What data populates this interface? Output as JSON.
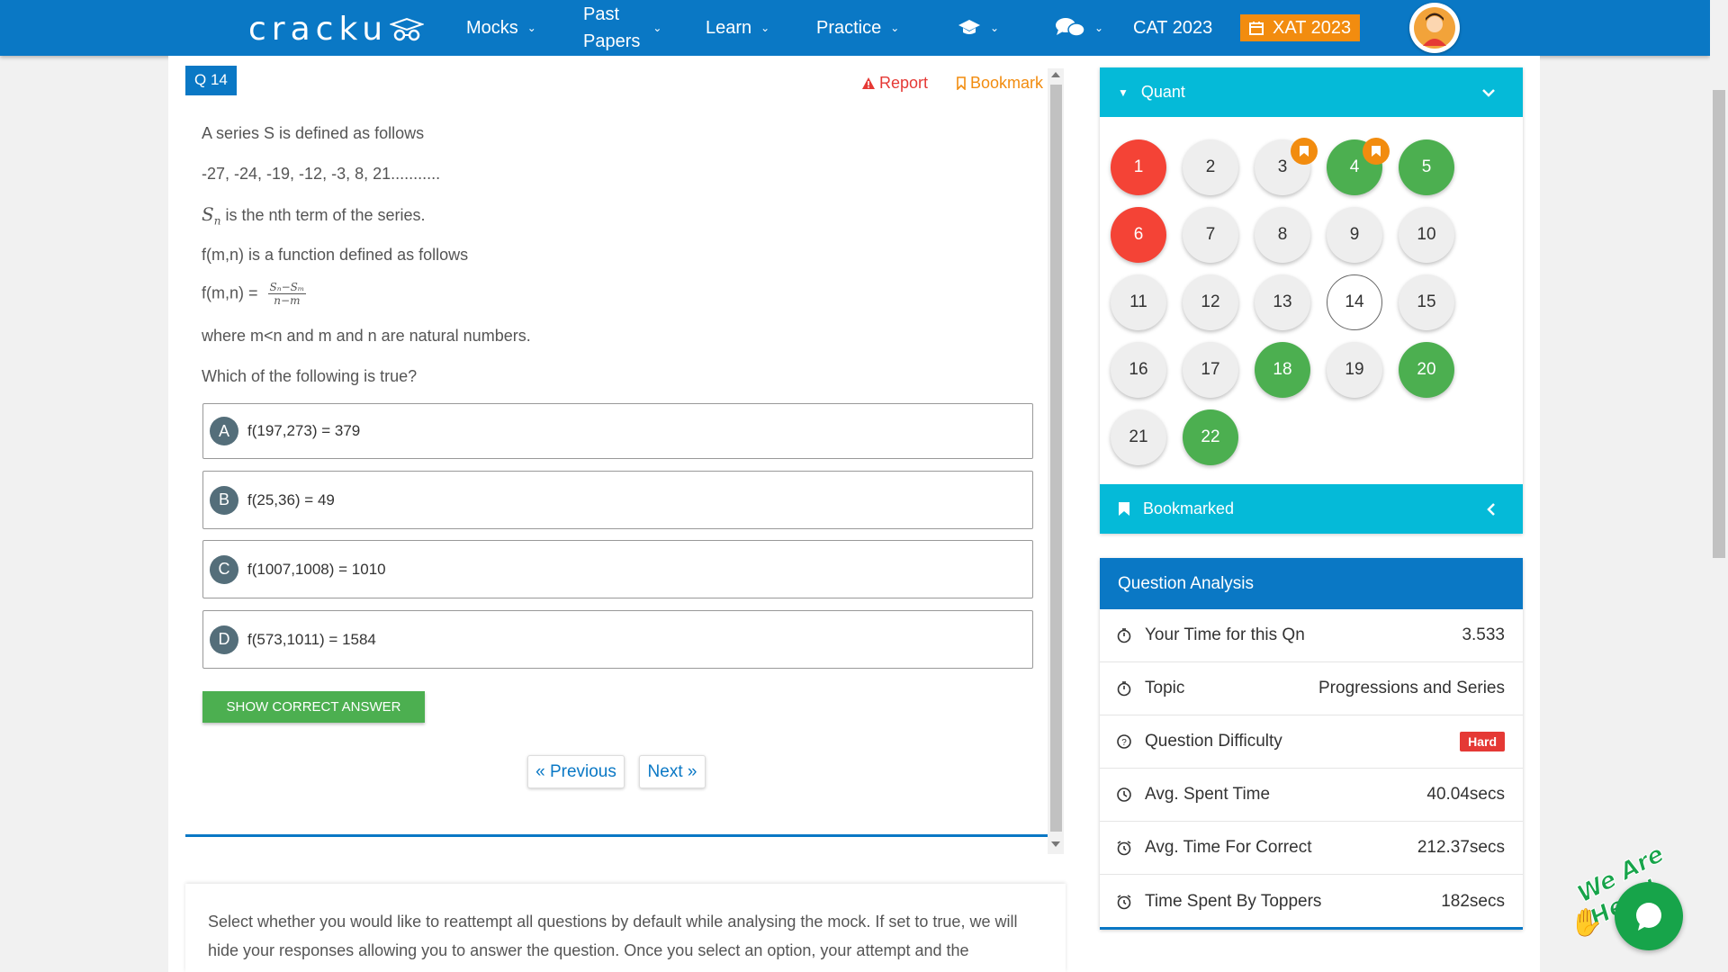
{
  "nav": {
    "logo": "cracku",
    "items": [
      {
        "label": "Mocks"
      },
      {
        "label_line1": "Past",
        "label_line2": "Papers"
      },
      {
        "label": "Learn"
      },
      {
        "label": "Practice"
      }
    ],
    "cat_link": "CAT 2023",
    "xat_button": "XAT 2023"
  },
  "question": {
    "badge": "Q 14",
    "report": "Report",
    "bookmark": "Bookmark",
    "line1": "A series S is defined as follows",
    "line2": "-27, -24, -19, -12, -3, 8, 21...........",
    "sn_symbol": "S",
    "sn_sub": "n",
    "line3": "is the nth term of the series.",
    "line4": "f(m,n) is a function defined as follows",
    "fmn_prefix": "f(m,n) =",
    "frac_num": "Sₙ−Sₘ",
    "frac_den": "n−m",
    "line5": "where m<n and m and n are natural numbers.",
    "line6": "Which of the following is true?",
    "options": [
      {
        "letter": "A",
        "text": "f(197,273) = 379"
      },
      {
        "letter": "B",
        "text": "f(25,36) = 49"
      },
      {
        "letter": "C",
        "text": "f(1007,1008) = 1010"
      },
      {
        "letter": "D",
        "text": "f(573,1011) = 1584"
      }
    ],
    "show_answer": "SHOW CORRECT ANSWER",
    "previous": "« Previous",
    "next": "Next »"
  },
  "info_text": "Select whether you would like to reattempt all questions by default while analysing the mock. If set to true, we will hide your responses allowing you to answer the question. Once you select an option, your attempt and the",
  "palette": {
    "section": "Quant",
    "numbers": [
      "1",
      "2",
      "3",
      "4",
      "5",
      "6",
      "7",
      "8",
      "9",
      "10",
      "11",
      "12",
      "13",
      "14",
      "15",
      "16",
      "17",
      "18",
      "19",
      "20",
      "21",
      "22"
    ],
    "bookmarked_label": "Bookmarked"
  },
  "analysis": {
    "title": "Question Analysis",
    "rows": [
      {
        "label": "Your Time for this Qn",
        "value": "3.533"
      },
      {
        "label": "Topic",
        "value": "Progressions and Series"
      },
      {
        "label": "Question Difficulty",
        "value": "Hard"
      },
      {
        "label": "Avg. Spent Time",
        "value": "40.04secs"
      },
      {
        "label": "Avg. Time For Correct",
        "value": "212.37secs"
      },
      {
        "label": "Time Spent By Toppers",
        "value": "182secs"
      }
    ]
  },
  "chat": {
    "tagline": "We Are Here!"
  },
  "colors": {
    "primary": "#0a78c5",
    "section": "#05bad8",
    "correct": "#4caf50",
    "wrong": "#f44336",
    "accent": "#f28c0f"
  }
}
